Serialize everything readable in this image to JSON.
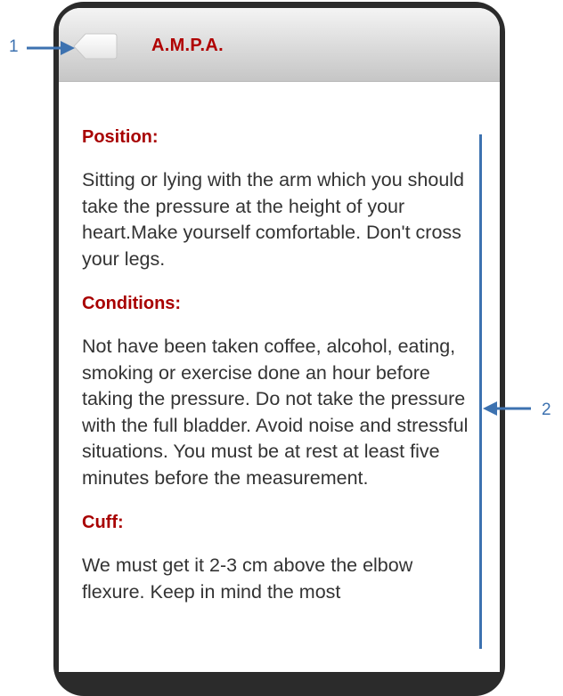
{
  "header": {
    "title": "A.M.P.A."
  },
  "sections": [
    {
      "heading": "Position:",
      "body": "Sitting or lying with the arm which you should take the pressure at the height of your heart.Make yourself comfortable. Don't cross your legs."
    },
    {
      "heading": "Conditions:",
      "body": "Not have been taken coffee, alcohol, eating, smoking or exercise done an hour before taking the pressure. Do not take the pressure with the full bladder. Avoid noise and stressful situations. You must be at rest at least five minutes before the measurement."
    },
    {
      "heading": "Cuff:",
      "body": "We must get it 2-3 cm above the elbow flexure. Keep in mind the most"
    }
  ],
  "annotations": {
    "callout_1": "1",
    "callout_2": "2"
  },
  "colors": {
    "heading": "#a80000",
    "annotation": "#3d72b0",
    "frame": "#2b2b2b"
  },
  "icons": {
    "back": "back-arrow-icon"
  }
}
